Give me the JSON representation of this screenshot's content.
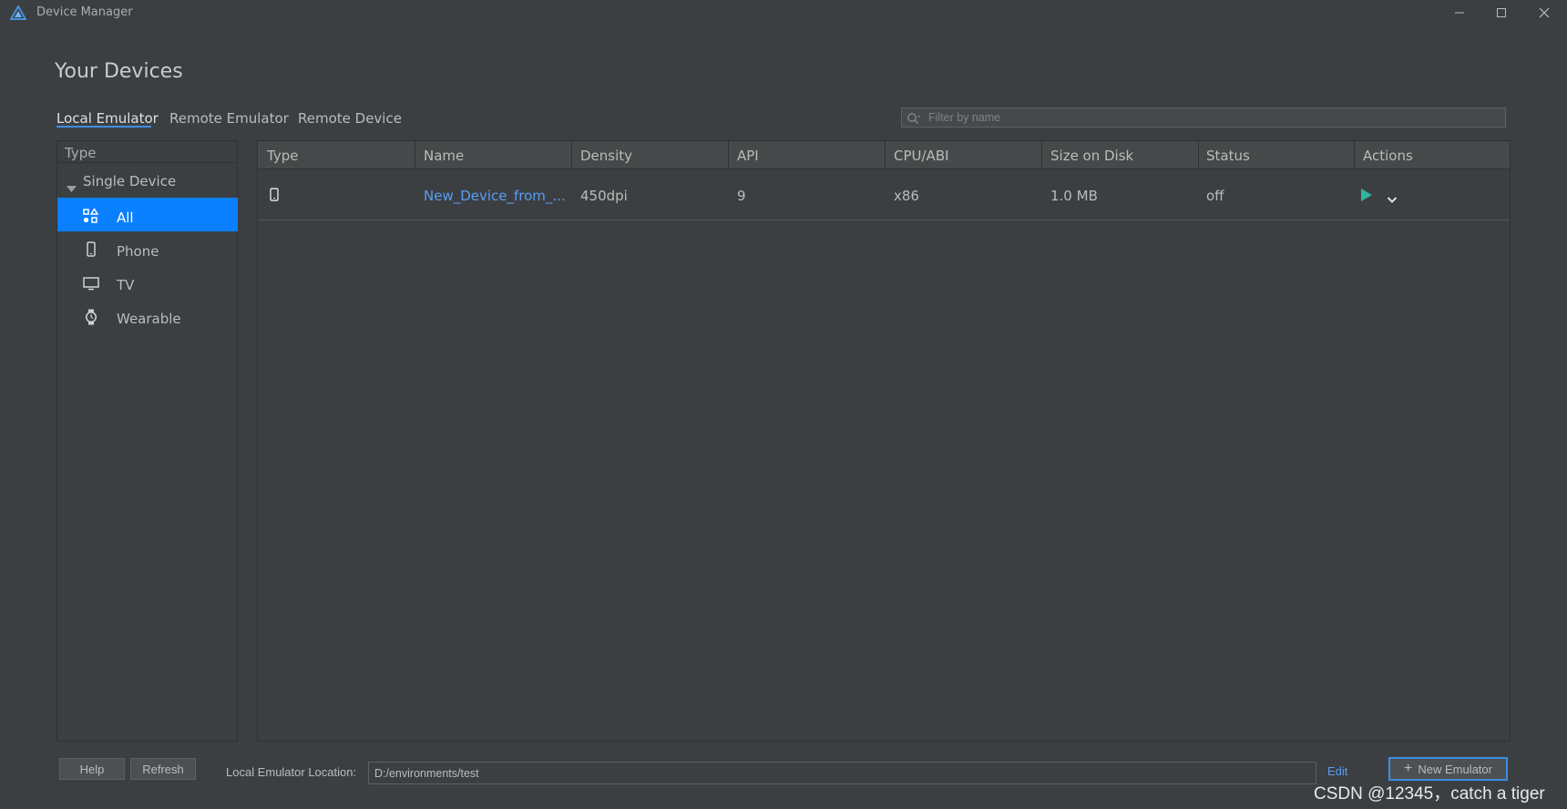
{
  "window": {
    "title": "Device Manager"
  },
  "page": {
    "title": "Your Devices"
  },
  "tabs": [
    {
      "label": "Local Emulator",
      "active": true
    },
    {
      "label": "Remote Emulator",
      "active": false
    },
    {
      "label": "Remote Device",
      "active": false
    }
  ],
  "search": {
    "placeholder": "Filter by name",
    "value": ""
  },
  "type_panel": {
    "header": "Type",
    "group_label": "Single Device",
    "items": [
      {
        "label": "All",
        "icon": "apps-grid-icon",
        "selected": true
      },
      {
        "label": "Phone",
        "icon": "phone-icon",
        "selected": false
      },
      {
        "label": "TV",
        "icon": "tv-icon",
        "selected": false
      },
      {
        "label": "Wearable",
        "icon": "watch-icon",
        "selected": false
      }
    ]
  },
  "table": {
    "columns": [
      "Type",
      "Name",
      "Density",
      "API",
      "CPU/ABI",
      "Size on Disk",
      "Status",
      "Actions"
    ],
    "rows": [
      {
        "type_icon": "phone-icon",
        "name": "New_Device_from_...",
        "density": "450dpi",
        "api": "9",
        "cpu_abi": "x86",
        "size_on_disk": "1.0 MB",
        "status": "off",
        "actions": [
          "run-icon",
          "chevron-down-icon"
        ]
      }
    ]
  },
  "footer": {
    "help_label": "Help",
    "refresh_label": "Refresh",
    "location_label": "Local Emulator Location:",
    "location_value": "D:/environments/test",
    "edit_label": "Edit",
    "new_emulator_label": "New Emulator"
  },
  "watermark": "CSDN @12345，catch a tiger",
  "colors": {
    "background": "#3c3f41",
    "selection": "#0a7fff",
    "link": "#589df6",
    "accent": "#3d8fe2",
    "run": "#2fb3a2"
  }
}
